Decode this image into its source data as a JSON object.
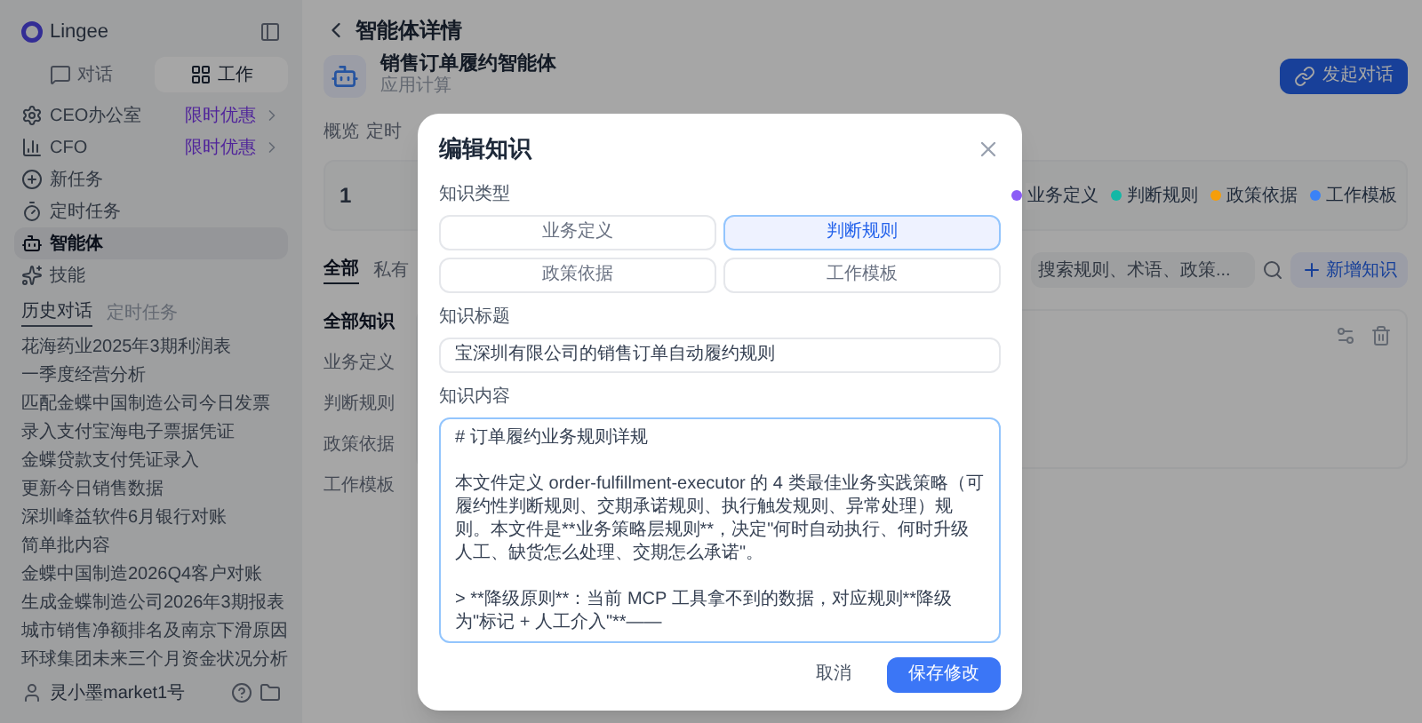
{
  "sidebar": {
    "logo": "Lingee",
    "tabs": [
      {
        "label": "对话",
        "selected": false
      },
      {
        "label": "工作",
        "selected": true
      }
    ],
    "nav": [
      {
        "label": "CEO办公室",
        "badge": "限时优惠",
        "selected": false
      },
      {
        "label": "CFO",
        "badge": "限时优惠",
        "selected": false
      },
      {
        "label": "新任务",
        "selected": false
      },
      {
        "label": "定时任务",
        "selected": false
      },
      {
        "label": "智能体",
        "selected": true
      },
      {
        "label": "技能",
        "selected": false
      }
    ],
    "history_tabs": [
      {
        "label": "历史对话",
        "selected": true
      },
      {
        "label": "定时任务",
        "selected": false
      }
    ],
    "history": [
      "花海药业2025年3期利润表",
      "一季度经营分析",
      "匹配金蝶中国制造公司今日发票",
      "录入支付宝海电子票据凭证",
      "金蝶贷款支付凭证录入",
      "更新今日销售数据",
      "深圳峰益软件6月银行对账",
      "简单批内容",
      "金蝶中国制造2026Q4客户对账",
      "生成金蝶制造公司2026年3期报表",
      "城市销售净额排名及南京下滑原因",
      "环球集团未来三个月资金状况分析"
    ],
    "user": "灵小墨market1号"
  },
  "page": {
    "title": "智能体详情",
    "agent_name": "销售订单履约智能体",
    "agent_subtitle": "应用计算",
    "start_button": "发起对话",
    "tabs": [
      "概览",
      "定时"
    ],
    "stat": "1",
    "legend": [
      {
        "label": "业务定义",
        "color": "#8b5cf6"
      },
      {
        "label": "判断规则",
        "color": "#14b8a6"
      },
      {
        "label": "政策依据",
        "color": "#f59e0b"
      },
      {
        "label": "工作模板",
        "color": "#3b82f6"
      }
    ],
    "scope_tabs": [
      {
        "label": "全部",
        "selected": true
      },
      {
        "label": "私有",
        "selected": false
      }
    ],
    "categories": [
      {
        "label": "全部知识",
        "selected": true
      },
      {
        "label": "业务定义",
        "selected": false
      },
      {
        "label": "判断规则",
        "selected": false
      },
      {
        "label": "政策依据",
        "selected": false
      },
      {
        "label": "工作模板",
        "selected": false
      }
    ],
    "search": {
      "placeholder": "搜索规则、术语、政策..."
    },
    "add_button": "新增知识"
  },
  "dialog": {
    "title": "编辑知识",
    "type_label": "知识类型",
    "types": [
      {
        "label": "业务定义",
        "selected": false
      },
      {
        "label": "判断规则",
        "selected": true
      },
      {
        "label": "政策依据",
        "selected": false
      },
      {
        "label": "工作模板",
        "selected": false
      }
    ],
    "title_label": "知识标题",
    "title_value": "宝深圳有限公司的销售订单自动履约规则",
    "content_label": "知识内容",
    "content_paragraphs": [
      "# 订单履约业务规则详规",
      "本文件定义 order-fulfillment-executor 的 4 类最佳业务实践策略（可履约性判断规则、交期承诺规则、执行触发规则、异常处理）规则。本文件是**业务策略层规则**，决定\"何时自动执行、何时升级人工、缺货怎么处理、交期怎么承诺\"。",
      "> **降级原则**：当前 MCP 工具拿不到的数据，对应规则**降级为\"标记 + 人工介入\"**——"
    ],
    "cancel": "取消",
    "save": "保存修改"
  }
}
